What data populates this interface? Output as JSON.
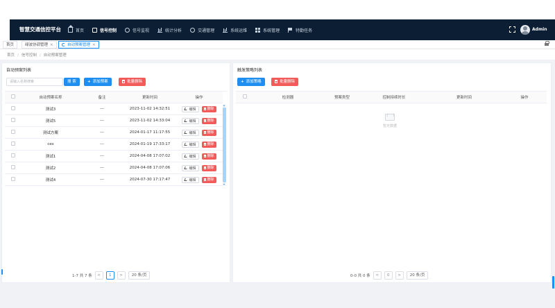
{
  "app": {
    "brand": "智慧交通信控平台",
    "username": "Admin"
  },
  "nav": [
    {
      "label": "首页",
      "icon": "home-icon",
      "active": false
    },
    {
      "label": "信号控制",
      "icon": "signal-control-icon",
      "active": true
    },
    {
      "label": "信号监视",
      "icon": "monitor-icon",
      "active": false
    },
    {
      "label": "统计分析",
      "icon": "chart-icon",
      "active": false
    },
    {
      "label": "交通管理",
      "icon": "traffic-icon",
      "active": false
    },
    {
      "label": "系统运维",
      "icon": "maintenance-icon",
      "active": false
    },
    {
      "label": "系统管理",
      "icon": "grid-icon",
      "active": false
    },
    {
      "label": "特勤任务",
      "icon": "flag-icon",
      "active": false
    }
  ],
  "tabs": [
    {
      "label": "首页",
      "closable": false,
      "active": false
    },
    {
      "label": "绿波协调管理",
      "closable": true,
      "active": false
    },
    {
      "label": "自动预案管理",
      "closable": true,
      "active": true
    }
  ],
  "breadcrumb": [
    "首页",
    "信号控制",
    "自动预案管理"
  ],
  "left": {
    "title": "自动预案列表",
    "search_placeholder": "请输入名称搜索",
    "search_label": "搜 索",
    "add_label": "添加预案",
    "batch_delete_label": "批量删除",
    "columns": [
      "自动预案名称",
      "备注",
      "更新时间",
      "操作"
    ],
    "rows": [
      {
        "name": "测试3",
        "remark": "---",
        "updated": "2023-11-02 14:32:51"
      },
      {
        "name": "测试5",
        "remark": "---",
        "updated": "2023-11-02 14:33:04"
      },
      {
        "name": "测试方案",
        "remark": "---",
        "updated": "2024-01-17 11:17:55"
      },
      {
        "name": "ces",
        "remark": "---",
        "updated": "2024-01-19 17:33:17"
      },
      {
        "name": "测试1",
        "remark": "---",
        "updated": "2024-04-08 17:07:02"
      },
      {
        "name": "测试2",
        "remark": "---",
        "updated": "2024-04-08 17:07:06"
      },
      {
        "name": "测试4",
        "remark": "---",
        "updated": "2024-07-30 17:17:47"
      }
    ],
    "edit_label": "编辑",
    "delete_label": "删除",
    "pager": {
      "summary": "1-7 共 7 条",
      "prev": "<",
      "current": "1",
      "next": ">",
      "size": "20 条/页"
    }
  },
  "right": {
    "title": "触发策略列表",
    "add_label": "添加策略",
    "batch_delete_label": "批量删除",
    "columns": [
      "检测器",
      "预案类型",
      "控制持续时长",
      "更新时间",
      "操作"
    ],
    "empty_text": "暂无数据",
    "pager": {
      "summary": "0-0 共 0 条",
      "prev": "<",
      "current": "0",
      "next": ">",
      "size": "20 条/页"
    }
  }
}
